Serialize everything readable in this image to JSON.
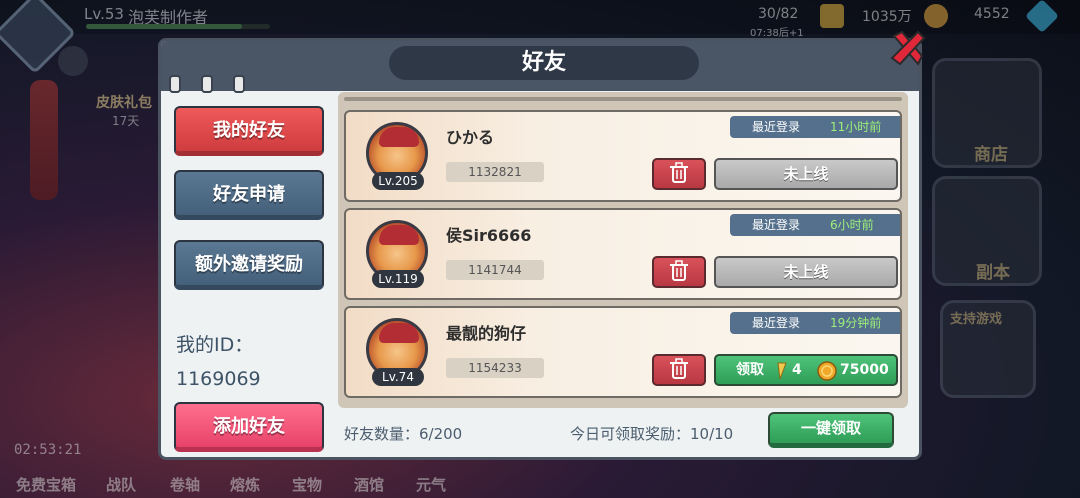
{
  "hud": {
    "level": "Lv.53",
    "player_name": "泡芙制作者",
    "exp_progress": 0.85,
    "stamina": "30/82",
    "stamina_timer": "07:38后+1",
    "gold": "1035万",
    "diamonds": "4552",
    "skin_gift_label": "皮肤礼包",
    "skin_gift_days": "17天",
    "countdown": "02:53:21"
  },
  "side_menu": {
    "shop_label": "商店",
    "dungeon_label": "副本",
    "support_label": "支持游戏"
  },
  "bottom_tabs": [
    "免费宝箱",
    "战队",
    "卷轴",
    "熔炼",
    "宝物",
    "酒馆",
    "元气"
  ],
  "dialog": {
    "title": "好友",
    "tabs": {
      "my_friends": "我的好友",
      "friend_requests": "好友申请",
      "invite_rewards": "额外邀请奖励"
    },
    "my_id_label": "我的ID：",
    "my_id_value": "1169069",
    "add_friend": "添加好友",
    "friends": [
      {
        "name": "ひかる",
        "level": "Lv.205",
        "id": "1132821",
        "login_label": "最近登录",
        "login_time": "11小时前",
        "action": "未上线"
      },
      {
        "name": "侯Sir6666",
        "level": "Lv.119",
        "id": "1141744",
        "login_label": "最近登录",
        "login_time": "6小时前",
        "action": "未上线"
      },
      {
        "name": "最靓的狗仔",
        "level": "Lv.74",
        "id": "1154233",
        "login_label": "最近登录",
        "login_time": "19分钟前",
        "claim_label": "领取",
        "claim_count": "4",
        "claim_amount": "75000"
      }
    ],
    "friend_count_label": "好友数量：6/200",
    "daily_rewards_label": "今日可领取奖励：10/10",
    "claim_all": "一键领取"
  },
  "colors": {
    "primary_red": "#cf3c3f",
    "primary_blue": "#44607b",
    "claim_green": "#2f9d57",
    "header_dark": "#4a5566",
    "online_time": "#9cf07b"
  }
}
